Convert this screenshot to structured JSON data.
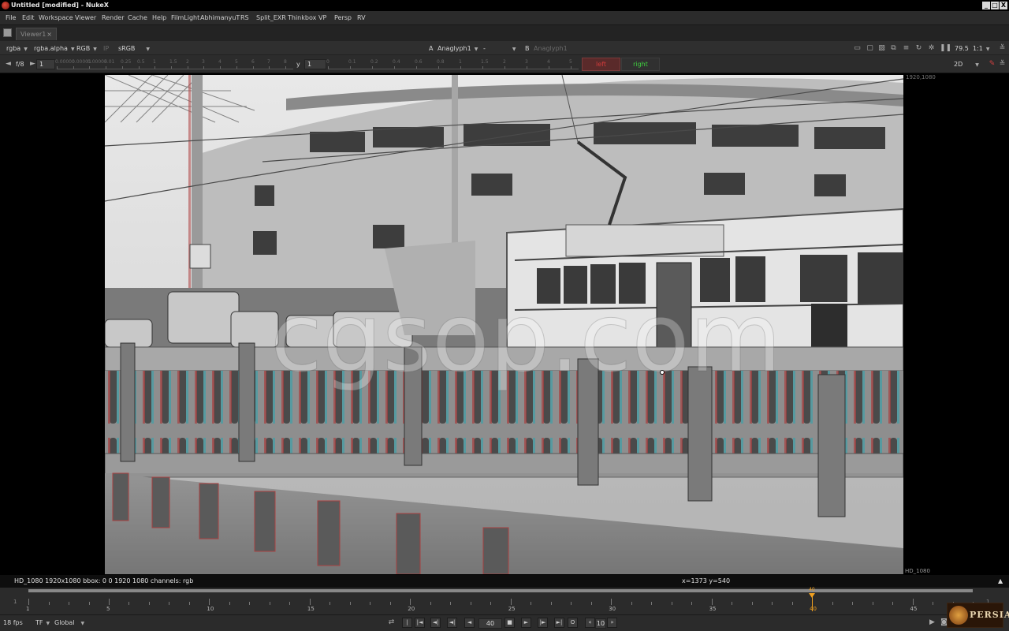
{
  "window": {
    "title": "Untitled [modified] - NukeX",
    "minimize_glyph": "_",
    "maximize_glyph": "□",
    "close_glyph": "X"
  },
  "menu": [
    "File",
    "Edit",
    "Workspace",
    "Viewer",
    "Render",
    "Cache",
    "Help",
    "FilmLight",
    "AbhimanyuT",
    "RS",
    "Split_EXR",
    "Thinkbox",
    "VP",
    "Persp",
    "RV"
  ],
  "tabs": {
    "viewer_tab": "Viewer1",
    "close_glyph": "×"
  },
  "toolbar1": {
    "layer": "rgba",
    "alpha_channel": "rgba.alpha",
    "display_channels": "RGB",
    "ip_label": "IP",
    "lut": "sRGB",
    "input_a_label": "A",
    "input_a": "Anaglyph1",
    "composite_mode": "-",
    "input_b_label": "B",
    "input_b": "Anaglyph1",
    "zoom": "79.5",
    "ratio": "1:1"
  },
  "toolbar2": {
    "fstop_label": "f/8",
    "gain_value": "1",
    "gamma_label": "y",
    "gamma_value": "1",
    "view_left": "left",
    "view_right": "right",
    "view_mode": "2D",
    "gain_ticks": [
      "0.00000",
      "0.00001",
      "0.00005",
      "0.01",
      "0.25",
      "0.5",
      "1",
      "1.5",
      "2",
      "3",
      "4",
      "5",
      "6",
      "7",
      "8"
    ],
    "gamma_ticks": [
      "0",
      "0.1",
      "0.2",
      "0.4",
      "0.6",
      "0.8",
      "1",
      "1.5",
      "2",
      "3",
      "4",
      "5"
    ]
  },
  "viewer": {
    "format_top_right": "1920,1080",
    "format_bottom_right": "HD_1080",
    "watermark": "cgsop.com"
  },
  "infobar": {
    "format_info": "HD_1080 1920x1080  bbox: 0 0 1920 1080 channels: rgb",
    "coords": "x=1373 y=540"
  },
  "timeline": {
    "start": "1",
    "end": "1",
    "current_frame": 40,
    "first": 1,
    "last": 48,
    "marks": [
      1,
      5,
      10,
      15,
      20,
      25,
      30,
      35,
      40,
      45
    ]
  },
  "playback": {
    "fps": "18 fps",
    "tf": "TF",
    "scope": "Global",
    "frame": "40",
    "increment": "10",
    "prev_inc_glyph": "«",
    "next_inc_glyph": "»",
    "first_glyph": "|",
    "prev_key_glyph": "|◄",
    "prev_frame_glyph": "◄|",
    "play_back_glyph": "◄",
    "stop_glyph": "■",
    "play_glyph": "►",
    "next_frame_glyph": "|►",
    "next_key_glyph": "►|",
    "last_glyph": "O"
  },
  "logo_text": "PERSIA",
  "colors": {
    "accent_orange": "#f0a020",
    "left_red": "#b03030",
    "right_green": "#3fcf3f"
  }
}
